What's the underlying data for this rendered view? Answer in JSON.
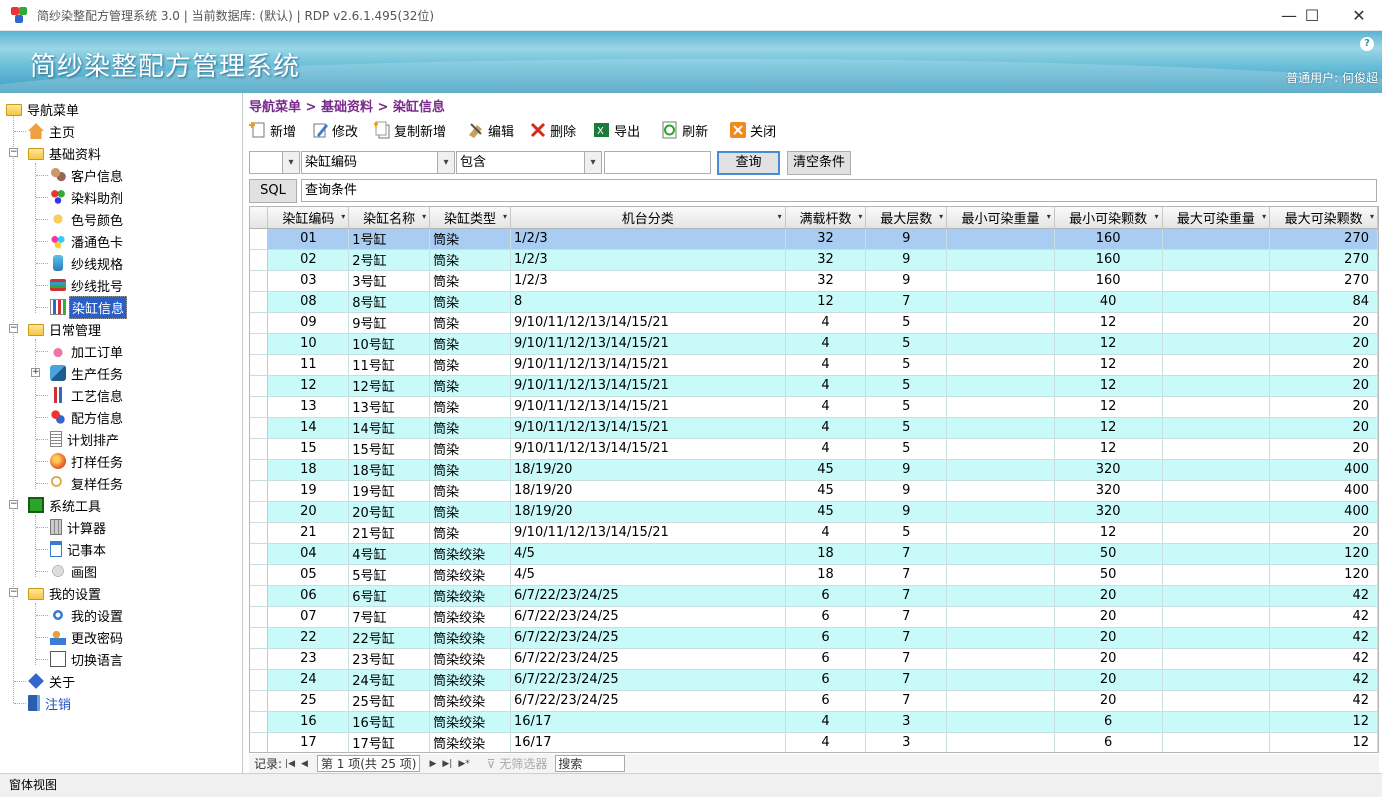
{
  "window": {
    "title": "简纱染整配方管理系统 3.0 | 当前数据库: (默认) | RDP v2.6.1.495(32位)",
    "minimize": "—",
    "maximize": "☐",
    "close": "✕"
  },
  "banner": {
    "title": "简纱染整配方管理系统",
    "help": "?",
    "user": "普通用户: 何俊超"
  },
  "sidebar": {
    "root": "导航菜单",
    "home": "主页",
    "groups": [
      {
        "label": "基础资料",
        "items": [
          "客户信息",
          "染料助剂",
          "色号颜色",
          "潘通色卡",
          "纱线规格",
          "纱线批号",
          "染缸信息"
        ]
      },
      {
        "label": "日常管理",
        "items": [
          "加工订单",
          "生产任务",
          "工艺信息",
          "配方信息",
          "计划排产",
          "打样任务",
          "复样任务"
        ]
      },
      {
        "label": "系统工具",
        "items": [
          "计算器",
          "记事本",
          "画图"
        ]
      },
      {
        "label": "我的设置",
        "items": [
          "我的设置",
          "更改密码",
          "切换语言"
        ]
      }
    ],
    "about": "关于",
    "logout": "注销"
  },
  "breadcrumb": "导航菜单 > 基础资料 > 染缸信息",
  "toolbar": {
    "add": "新增",
    "modify": "修改",
    "copy_add": "复制新增",
    "edit": "编辑",
    "delete": "删除",
    "export": "导出",
    "refresh": "刷新",
    "close": "关闭"
  },
  "filter": {
    "prefix": "",
    "field": "染缸编码",
    "operator": "包含",
    "value": "",
    "query": "查询",
    "clear": "清空条件"
  },
  "sql": {
    "label": "SQL",
    "condition": "查询条件"
  },
  "grid": {
    "columns": [
      "染缸编码",
      "染缸名称",
      "染缸类型",
      "机台分类",
      "满载杆数",
      "最大层数",
      "最小可染重量",
      "最小可染颗数",
      "最大可染重量",
      "最大可染颗数"
    ],
    "rows": [
      [
        "01",
        "1号缸",
        "筒染",
        "1/2/3",
        "32",
        "9",
        "",
        "160",
        "",
        "270"
      ],
      [
        "02",
        "2号缸",
        "筒染",
        "1/2/3",
        "32",
        "9",
        "",
        "160",
        "",
        "270"
      ],
      [
        "03",
        "3号缸",
        "筒染",
        "1/2/3",
        "32",
        "9",
        "",
        "160",
        "",
        "270"
      ],
      [
        "08",
        "8号缸",
        "筒染",
        "8",
        "12",
        "7",
        "",
        "40",
        "",
        "84"
      ],
      [
        "09",
        "9号缸",
        "筒染",
        "9/10/11/12/13/14/15/21",
        "4",
        "5",
        "",
        "12",
        "",
        "20"
      ],
      [
        "10",
        "10号缸",
        "筒染",
        "9/10/11/12/13/14/15/21",
        "4",
        "5",
        "",
        "12",
        "",
        "20"
      ],
      [
        "11",
        "11号缸",
        "筒染",
        "9/10/11/12/13/14/15/21",
        "4",
        "5",
        "",
        "12",
        "",
        "20"
      ],
      [
        "12",
        "12号缸",
        "筒染",
        "9/10/11/12/13/14/15/21",
        "4",
        "5",
        "",
        "12",
        "",
        "20"
      ],
      [
        "13",
        "13号缸",
        "筒染",
        "9/10/11/12/13/14/15/21",
        "4",
        "5",
        "",
        "12",
        "",
        "20"
      ],
      [
        "14",
        "14号缸",
        "筒染",
        "9/10/11/12/13/14/15/21",
        "4",
        "5",
        "",
        "12",
        "",
        "20"
      ],
      [
        "15",
        "15号缸",
        "筒染",
        "9/10/11/12/13/14/15/21",
        "4",
        "5",
        "",
        "12",
        "",
        "20"
      ],
      [
        "18",
        "18号缸",
        "筒染",
        "18/19/20",
        "45",
        "9",
        "",
        "320",
        "",
        "400"
      ],
      [
        "19",
        "19号缸",
        "筒染",
        "18/19/20",
        "45",
        "9",
        "",
        "320",
        "",
        "400"
      ],
      [
        "20",
        "20号缸",
        "筒染",
        "18/19/20",
        "45",
        "9",
        "",
        "320",
        "",
        "400"
      ],
      [
        "21",
        "21号缸",
        "筒染",
        "9/10/11/12/13/14/15/21",
        "4",
        "5",
        "",
        "12",
        "",
        "20"
      ],
      [
        "04",
        "4号缸",
        "筒染绞染",
        "4/5",
        "18",
        "7",
        "",
        "50",
        "",
        "120"
      ],
      [
        "05",
        "5号缸",
        "筒染绞染",
        "4/5",
        "18",
        "7",
        "",
        "50",
        "",
        "120"
      ],
      [
        "06",
        "6号缸",
        "筒染绞染",
        "6/7/22/23/24/25",
        "6",
        "7",
        "",
        "20",
        "",
        "42"
      ],
      [
        "07",
        "7号缸",
        "筒染绞染",
        "6/7/22/23/24/25",
        "6",
        "7",
        "",
        "20",
        "",
        "42"
      ],
      [
        "22",
        "22号缸",
        "筒染绞染",
        "6/7/22/23/24/25",
        "6",
        "7",
        "",
        "20",
        "",
        "42"
      ],
      [
        "23",
        "23号缸",
        "筒染绞染",
        "6/7/22/23/24/25",
        "6",
        "7",
        "",
        "20",
        "",
        "42"
      ],
      [
        "24",
        "24号缸",
        "筒染绞染",
        "6/7/22/23/24/25",
        "6",
        "7",
        "",
        "20",
        "",
        "42"
      ],
      [
        "25",
        "25号缸",
        "筒染绞染",
        "6/7/22/23/24/25",
        "6",
        "7",
        "",
        "20",
        "",
        "42"
      ],
      [
        "16",
        "16号缸",
        "筒染绞染",
        "16/17",
        "4",
        "3",
        "",
        "6",
        "",
        "12"
      ],
      [
        "17",
        "17号缸",
        "筒染绞染",
        "16/17",
        "4",
        "3",
        "",
        "6",
        "",
        "12"
      ]
    ]
  },
  "footer": {
    "record_label": "记录:",
    "position": "第 1 项(共 25 项)",
    "nofilter": "无筛选器",
    "search": "搜索"
  },
  "status": "窗体视图",
  "colors": {
    "selected_row": "#a9cdf2",
    "alt_row": "#c8fafa",
    "breadcrumb": "#7a2a8c",
    "sidebar_selected": "#2b5fc7"
  }
}
